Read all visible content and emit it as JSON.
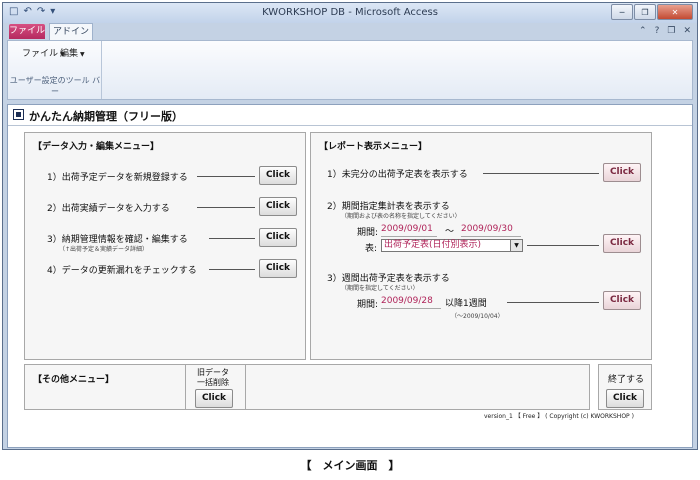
{
  "window": {
    "title": "KWORKSHOP DB - Microsoft Access",
    "qat_icons": [
      "save-icon",
      "undo-icon",
      "redo-icon",
      "customize-icon"
    ],
    "controls": [
      "minimize-icon",
      "restore-icon",
      "close-icon"
    ]
  },
  "ribbon": {
    "tabs": {
      "file": "ファイル",
      "addin": "アドイン"
    },
    "menus": {
      "file_menu": "ファイル",
      "edit_menu": "編集"
    },
    "group_label": "ユーザー設定のツール バー",
    "doc_controls": [
      "ribbon-min-icon",
      "help-icon",
      "doc-restore-icon",
      "doc-close-icon"
    ]
  },
  "form": {
    "title": "かんたん納期管理（フリー版）",
    "left_panel": {
      "title": "【データ入力・編集メニュー】",
      "items": [
        {
          "label": "1）出荷予定データを新規登録する",
          "button": "Click"
        },
        {
          "label": "2）出荷実績データを入力する",
          "button": "Click"
        },
        {
          "label": "3）納期管理情報を確認・編集する",
          "sub": "（↑出荷予定＆実績データ詳細）",
          "button": "Click"
        },
        {
          "label": "4）データの更新漏れをチェックする",
          "button": "Click"
        }
      ]
    },
    "right_panel": {
      "title": "【レポート表示メニュー】",
      "item1": {
        "label": "1）未完分の出荷予定表を表示する",
        "button": "Click"
      },
      "item2": {
        "label": "2）期間指定集計表を表示する",
        "sub": "（期間および表の名称を指定してください）",
        "period_label": "期間:",
        "from": "2009/09/01",
        "tilde": "～",
        "to": "2009/09/30",
        "table_label": "表:",
        "table_value": "出荷予定表(日付別表示)",
        "button": "Click"
      },
      "item3": {
        "label": "3）週間出荷予定表を表示する",
        "sub": "（期間を指定してください）",
        "period_label": "期間:",
        "from": "2009/09/28",
        "suffix": "以降1週間",
        "note": "（～2009/10/04）",
        "button": "Click"
      }
    },
    "other_panel": {
      "title": "【その他メニュー】",
      "old_data_label_1": "旧データ",
      "old_data_label_2": "一括削除",
      "button": "Click"
    },
    "exit_panel": {
      "label": "終了する",
      "button": "Click"
    },
    "footer": "version_1 【 Free 】  ( Copyright (c) KWORKSHOP )"
  },
  "caption": "【　メイン画面　】"
}
